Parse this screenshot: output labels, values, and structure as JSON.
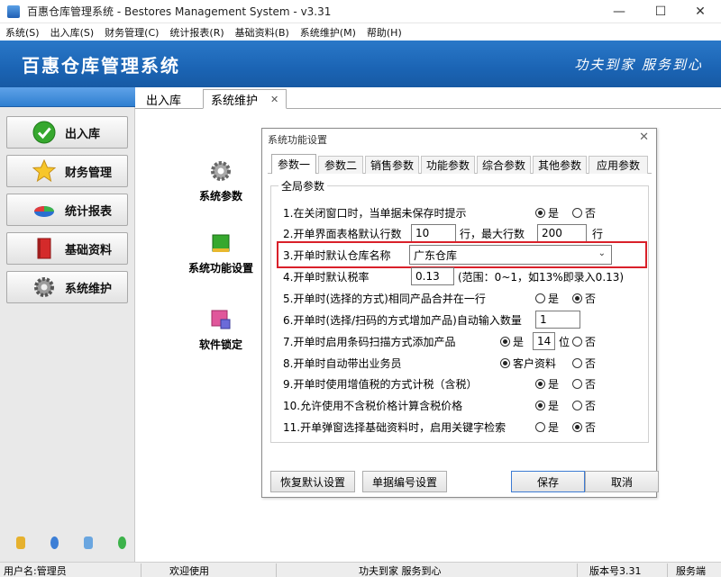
{
  "window": {
    "title": "百惠仓库管理系统 - Bestores Management System - v3.31",
    "controls": {
      "minimize": "—",
      "maximize": "☐",
      "close": "✕"
    }
  },
  "menu": [
    "系统(S)",
    "出入库(S)",
    "财务管理(C)",
    "统计报表(R)",
    "基础资料(B)",
    "系统维护(M)",
    "帮助(H)"
  ],
  "header": {
    "app_name": "百惠仓库管理系统",
    "slogan": "功夫到家  服务到心"
  },
  "sidebar": {
    "buttons": [
      {
        "label": "出入库",
        "icon": "green-check-icon"
      },
      {
        "label": "财务管理",
        "icon": "star-icon"
      },
      {
        "label": "统计报表",
        "icon": "pie-chart-icon"
      },
      {
        "label": "基础资料",
        "icon": "red-book-icon"
      },
      {
        "label": "系统维护",
        "icon": "gear-icon"
      }
    ],
    "bottom_icons": [
      "pencil-icon",
      "clock-icon",
      "monitor-icon",
      "back-arrow-icon"
    ]
  },
  "main": {
    "tabs": [
      {
        "label": "出入库",
        "active": false
      },
      {
        "label": "系统维护",
        "active": true,
        "close": "✕"
      }
    ],
    "functions": [
      {
        "label": "系统参数",
        "icon": "gear-icon"
      },
      {
        "label": "系统功能设置",
        "icon": "green-cube-icon"
      },
      {
        "label": "软件锁定",
        "icon": "lock-app-icon"
      }
    ]
  },
  "dialog": {
    "title": "系统功能设置",
    "close": "✕",
    "tabs": [
      "参数一",
      "参数二",
      "销售参数",
      "功能参数",
      "综合参数",
      "其他参数",
      "应用参数"
    ],
    "active_tab": "参数一",
    "group_title": "全局参数",
    "options": {
      "r1": {
        "label": "1.在关闭窗口时，当单据未保存时提示",
        "yes": "是",
        "no": "否",
        "selected": "是"
      },
      "r2": {
        "label": "2.开单界面表格默认行数",
        "value": "10",
        "unit1": "行，最大行数",
        "max": "200",
        "unit2": "行"
      },
      "r3": {
        "label": "3.开单时默认仓库名称",
        "value": "广东仓库"
      },
      "r4": {
        "label": "4.开单时默认税率",
        "value": "0.13",
        "hint": "(范围：0~1，如13%即录入0.13)"
      },
      "r5": {
        "label": "5.开单时(选择的方式)相同产品合并在一行",
        "yes": "是",
        "no": "否",
        "selected": "否"
      },
      "r6": {
        "label": "6.开单时(选择/扫码的方式增加产品)自动输入数量",
        "value": "1"
      },
      "r7": {
        "label": "7.开单时启用条码扫描方式添加产品",
        "yes": "是",
        "value": "14",
        "unit": "位",
        "no": "否",
        "selected": "是"
      },
      "r8": {
        "label": "8.开单时自动带出业务员",
        "yes": "客户资料",
        "no": "否",
        "selected": "客户资料"
      },
      "r9": {
        "label": "9.开单时使用增值税的方式计税（含税）",
        "yes": "是",
        "no": "否",
        "selected": "是"
      },
      "r10": {
        "label": "10.允许使用不含税价格计算含税价格",
        "yes": "是",
        "no": "否",
        "selected": "是"
      },
      "r11": {
        "label": "11.开单弹窗选择基础资料时，启用关键字检索",
        "yes": "是",
        "no": "否",
        "selected": "否"
      }
    },
    "buttons": {
      "restore": "恢复默认设置",
      "numbering": "单据编号设置",
      "save": "保存",
      "cancel": "取消"
    }
  },
  "statusbar": {
    "user": "用户名:管理员",
    "welcome": "欢迎使用",
    "slogan": "功夫到家 服务到心",
    "version": "版本号3.31",
    "side": "服务端"
  },
  "colors": {
    "header_blue": "#1b64b4",
    "highlight_red": "#d9202a"
  }
}
